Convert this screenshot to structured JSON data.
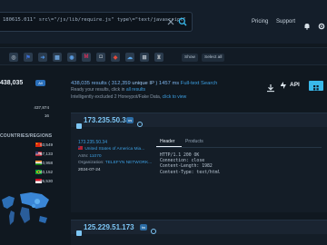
{
  "search": {
    "query": "180615.011\" src\\=\"/js/lib/require.js\" type\\=\"text/javascript\""
  },
  "nav": {
    "pricing": "Pricing",
    "support": "Support"
  },
  "filters": {
    "chips": [
      {
        "icon": "target-icon",
        "color": "#9aa6b2",
        "glyph": "◎"
      },
      {
        "icon": "flag-icon",
        "color": "#3b6fd8",
        "glyph": "⚑"
      },
      {
        "icon": "arrow-right-icon",
        "color": "#4b8fe0",
        "glyph": "➜"
      },
      {
        "icon": "grid-icon",
        "color": "#6aa0d8",
        "glyph": "▦"
      },
      {
        "icon": "globe-icon",
        "color": "#5a9be0",
        "glyph": "◉"
      },
      {
        "icon": "m-logo-icon",
        "color": "#d8305a",
        "glyph": "M"
      },
      {
        "icon": "camera-icon",
        "color": "#b0b8c0",
        "glyph": "◘"
      },
      {
        "icon": "shield-icon",
        "color": "#e24b3b",
        "glyph": "◆"
      },
      {
        "icon": "cloud-icon",
        "color": "#5aa5e8",
        "glyph": "☁"
      },
      {
        "icon": "network-icon",
        "color": "#c0c8d0",
        "glyph": "⊞"
      },
      {
        "icon": "tower-icon",
        "color": "#a0a8b0",
        "glyph": "♜"
      }
    ],
    "actions": [
      "Show",
      "Select all"
    ]
  },
  "sidebar": {
    "total": "438,035",
    "toggle": "All",
    "rows": [
      {
        "label": "",
        "value": "437,874"
      },
      {
        "label": "",
        "value": "16"
      }
    ],
    "section_title": "COUNTRIES/REGIONS",
    "countries": [
      {
        "value": "93,549",
        "flag": "china"
      },
      {
        "value": "57,133",
        "flag": "us"
      },
      {
        "value": "40,958",
        "flag": "india"
      },
      {
        "value": "40,152",
        "flag": "brazil"
      },
      {
        "value": "25,530",
        "flag": "indonesia"
      }
    ]
  },
  "results": {
    "summary_prefix": "438,035 results ( 312,359",
    "summary_unique": "unique IP",
    "summary_time": ") 1457 ms",
    "full_text_search": "Full-text Search",
    "ready_line_prefix": "Ready your results, click in",
    "ready_line_all": "all results",
    "honeypot_line_prefix": "Intelligently excluded 2 Honeypot/Fake Data,",
    "honeypot_line_link": "click to view",
    "api_label": "API"
  },
  "cards": [
    {
      "ip": "173.235.50.34",
      "badge": "us",
      "location_code": "173.235.50.34",
      "country": "United States of America",
      "city": "Mia...",
      "asn_label": "ASN:",
      "asn": "11070",
      "org_label": "Organization:",
      "org": "TELEFYN NETWORK...",
      "date": "2024-07-24",
      "tabs": [
        "Header",
        "Products"
      ],
      "http": "HTTP/1.1 200 OK\nConnection: close\nContent-Length: 1982\nContent-Type: text/html"
    },
    {
      "ip": "125.229.51.173",
      "badge": "tw"
    }
  ]
}
